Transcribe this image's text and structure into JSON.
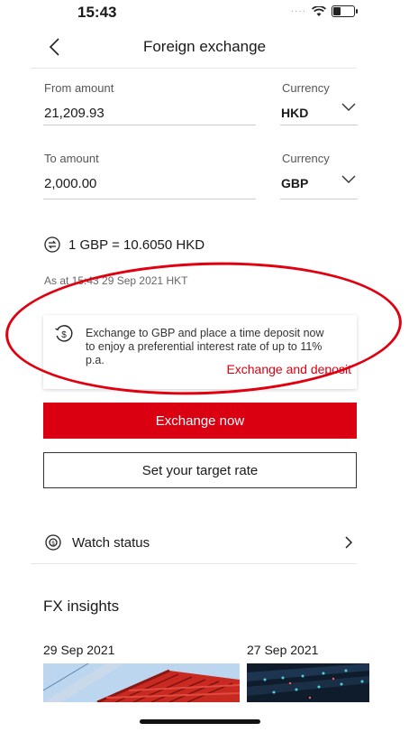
{
  "status_bar": {
    "time": "15:43"
  },
  "nav": {
    "title": "Foreign exchange"
  },
  "from": {
    "label": "From amount",
    "value": "21,209.93",
    "currency_label": "Currency",
    "currency": "HKD"
  },
  "to": {
    "label": "To amount",
    "value": "2,000.00",
    "currency_label": "Currency",
    "currency": "GBP"
  },
  "rate": {
    "text": "1 GBP = 10.6050 HKD",
    "as_at": "As at 15:43 29 Sep 2021 HKT"
  },
  "promo": {
    "text": "Exchange to GBP and place a time deposit now to enjoy a preferential interest rate of up to 11% p.a.",
    "link": "Exchange and deposit"
  },
  "actions": {
    "primary": "Exchange now",
    "secondary": "Set your target rate"
  },
  "watch": {
    "label": "Watch status"
  },
  "insights": {
    "title": "FX insights",
    "cards": [
      {
        "date": "29 Sep 2021"
      },
      {
        "date": "27 Sep 2021"
      }
    ]
  },
  "colors": {
    "accent": "#db0011",
    "annotation": "#e0000f"
  },
  "icons": [
    "chevron-left-icon",
    "chevron-down-icon",
    "swap-icon",
    "dollar-clock-icon",
    "watch-status-icon",
    "chevron-right-icon"
  ]
}
